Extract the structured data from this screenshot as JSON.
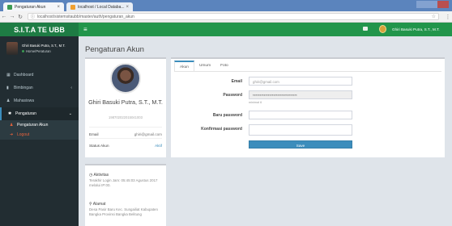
{
  "browser": {
    "tabs": [
      {
        "title": "Pengaturan Akun"
      },
      {
        "title": "localhost / Local Databa..."
      }
    ],
    "url": "localhost/sistemsitaubb/master/auth/pengaturan_akun"
  },
  "app": {
    "brand": "S.I.T.A TE UBB",
    "header_user": "Ghiri Basuki Putra, S.T., M.T."
  },
  "sidebar": {
    "user_name": "Ghiri Basuki Putra, S.T., M.T.",
    "user_status": "Home/Peraturan",
    "items": [
      {
        "label": "Dashboard",
        "icon": "dashboard-icon"
      },
      {
        "label": "Bimbingan",
        "icon": "book-icon"
      },
      {
        "label": "Mahasiswa",
        "icon": "users-icon"
      },
      {
        "label": "Pengaturan",
        "icon": "gear-icon"
      }
    ],
    "sub_items": [
      {
        "label": "Pengaturan Akun"
      },
      {
        "label": "Logout"
      }
    ]
  },
  "page": {
    "title": "Pengaturan Akun"
  },
  "profile": {
    "name": "Ghiri Basuki Putra, S.T., M.T.",
    "nip": "198702022015041003",
    "email_label": "Email",
    "email_value": "ghiri@gmail.com",
    "status_label": "Status Akun",
    "status_value": "Aktif"
  },
  "about": {
    "activity_heading": "Aktivitas",
    "activity_text": "Terakhir Login Jam: 05:45:03 Agustus 2017 melalui IP:00.",
    "address_heading": "Alamat",
    "address_text": "Desa Pasir Baru Kec. Sungailiat Kabupaten Bangka Provinsi Bangka Belitung"
  },
  "settings": {
    "tabs": [
      "Akun",
      "Umum",
      "Foto"
    ],
    "email_label": "Email",
    "email_value": "ghiri@gmail.com",
    "password_label": "Password",
    "password_value": "********************************",
    "password_help": "minimal 6",
    "new_password_label": "Baru password",
    "confirm_password_label": "Konfirmasi password",
    "save_button": "Save"
  }
}
